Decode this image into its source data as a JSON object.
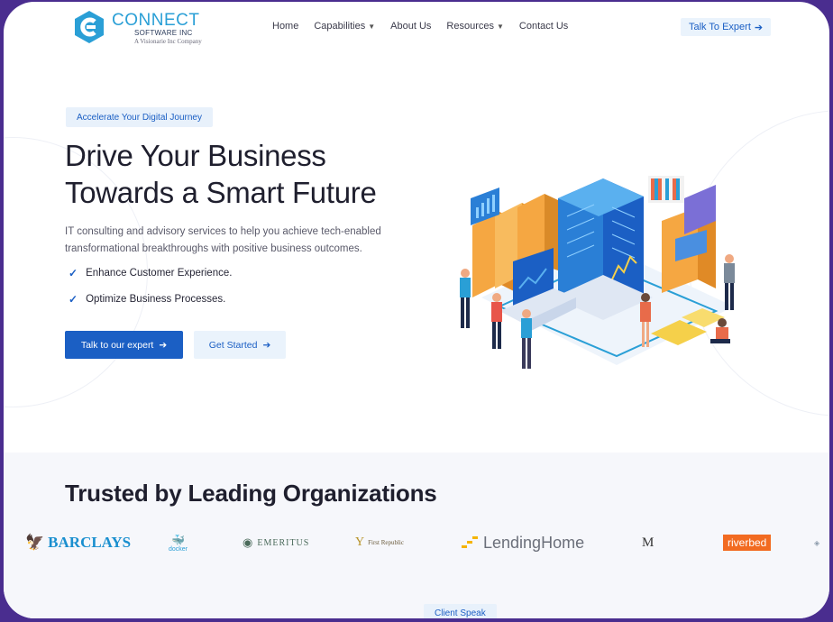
{
  "header": {
    "logo": {
      "name": "CONNECT",
      "sub": "SOFTWARE INC",
      "tagline": "A Visionarie Inc Company"
    },
    "nav": [
      {
        "label": "Home",
        "dropdown": false
      },
      {
        "label": "Capabilities",
        "dropdown": true
      },
      {
        "label": "About Us",
        "dropdown": false
      },
      {
        "label": "Resources",
        "dropdown": true
      },
      {
        "label": "Contact Us",
        "dropdown": false
      }
    ],
    "cta": "Talk To Expert"
  },
  "hero": {
    "badge": "Accelerate Your Digital Journey",
    "title_line1": "Drive Your Business",
    "title_line2": "Towards a Smart Future",
    "description": "IT consulting and advisory services to help you achieve tech-enabled transformational breakthroughs with positive business outcomes.",
    "checks": [
      "Enhance Customer Experience.",
      "Optimize Business Processes."
    ],
    "primary_button": "Talk to our expert",
    "secondary_button": "Get Started"
  },
  "trusted": {
    "title": "Trusted by Leading Organizations",
    "logos": [
      "BARCLAYS",
      "docker",
      "EMERITUS",
      "First Republic",
      "LendingHome",
      "M",
      "riverbed"
    ]
  },
  "client_speak": "Client Speak",
  "colors": {
    "primary": "#1b5fc4",
    "accent_light": "#eaf3fc",
    "frame": "#4a2d8f",
    "logo_blue": "#2a9fd6"
  }
}
